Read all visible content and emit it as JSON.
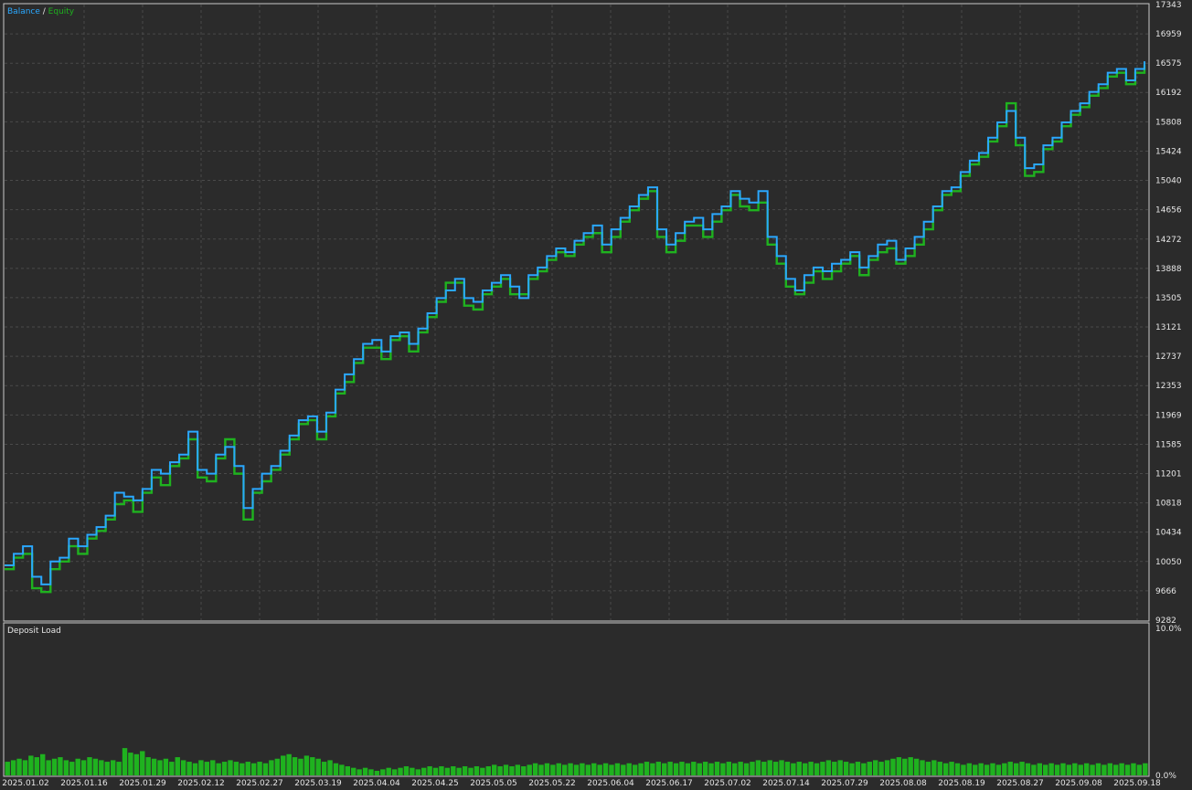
{
  "legend": {
    "balance_label": "Balance",
    "separator": " / ",
    "equity_label": "Equity"
  },
  "colors": {
    "background": "#2b2b2b",
    "grid": "#4a4a4a",
    "balance": "#2aa8ff",
    "equity": "#1fb21f",
    "volume": "#1fb21f",
    "text": "#e6e6e6",
    "border": "#c8c8c8"
  },
  "chart_data": [
    {
      "type": "line",
      "title": "",
      "legend_position": "top-left",
      "grid": true,
      "ylim": [
        9282,
        17343
      ],
      "y_ticks": [
        "17343",
        "16959",
        "16575",
        "16192",
        "15808",
        "15424",
        "15040",
        "14656",
        "14272",
        "13888",
        "13505",
        "13121",
        "12737",
        "12353",
        "11969",
        "11585",
        "11201",
        "10818",
        "10434",
        "10050",
        "9666",
        "9282"
      ],
      "x_ticks": [
        "2025.01.02",
        "2025.01.16",
        "2025.01.29",
        "2025.02.12",
        "2025.02.27",
        "2025.03.19",
        "2025.04.04",
        "2025.04.25",
        "2025.05.05",
        "2025.05.22",
        "2025.06.04",
        "2025.06.17",
        "2025.07.02",
        "2025.07.14",
        "2025.07.29",
        "2025.08.08",
        "2025.08.19",
        "2025.08.27",
        "2025.09.08",
        "2025.09.18"
      ],
      "series": [
        {
          "name": "Balance",
          "x": [
            0,
            10,
            20,
            30,
            40,
            50,
            60,
            70,
            80,
            90,
            100,
            110,
            120,
            130,
            140,
            150,
            160,
            170,
            180,
            190,
            200,
            210,
            220,
            230,
            240,
            250,
            260,
            270,
            280,
            290,
            300,
            310,
            320,
            330,
            340,
            350,
            360,
            370,
            380,
            390,
            400,
            410,
            420,
            430,
            440,
            450,
            460,
            470,
            480,
            490,
            500,
            510,
            520,
            530,
            540,
            550,
            560,
            570,
            580,
            590,
            600,
            610,
            620,
            630,
            640,
            650,
            660,
            670,
            680,
            690,
            700,
            710,
            720,
            730,
            740,
            750,
            760,
            770,
            780,
            790,
            800,
            810,
            820,
            830,
            840,
            850,
            860,
            870,
            880,
            890,
            900,
            910,
            920,
            930,
            940,
            950,
            960,
            970,
            980,
            990,
            1000,
            1010,
            1020,
            1030,
            1040,
            1050,
            1060,
            1070,
            1080,
            1090,
            1100,
            1110,
            1120,
            1130,
            1140,
            1150,
            1160,
            1170,
            1180,
            1190,
            1200,
            1210,
            1220,
            1230,
            1240
          ],
          "y": [
            10000,
            10150,
            10250,
            9850,
            9750,
            10050,
            10100,
            10350,
            10250,
            10400,
            10500,
            10650,
            10950,
            10900,
            10850,
            11000,
            11250,
            11200,
            11350,
            11450,
            11750,
            11250,
            11200,
            11450,
            11550,
            11300,
            10750,
            11000,
            11200,
            11300,
            11500,
            11700,
            11900,
            11950,
            11750,
            12000,
            12300,
            12500,
            12700,
            12900,
            12950,
            12800,
            13000,
            13050,
            12900,
            13100,
            13300,
            13500,
            13600,
            13750,
            13500,
            13450,
            13600,
            13700,
            13800,
            13650,
            13500,
            13800,
            13900,
            14050,
            14150,
            14100,
            14250,
            14350,
            14450,
            14200,
            14400,
            14550,
            14700,
            14850,
            14950,
            14400,
            14200,
            14350,
            14500,
            14550,
            14400,
            14600,
            14700,
            14900,
            14800,
            14750,
            14900,
            14300,
            14050,
            13750,
            13600,
            13800,
            13900,
            13850,
            13950,
            14000,
            14100,
            13900,
            14050,
            14200,
            14250,
            14000,
            14150,
            14300,
            14500,
            14700,
            14900,
            14950,
            15150,
            15300,
            15400,
            15600,
            15800,
            15950,
            15600,
            15200,
            15250,
            15500,
            15600,
            15800,
            15950,
            16050,
            16200,
            16300,
            16450,
            16500,
            16350,
            16500,
            16600
          ]
        },
        {
          "name": "Equity",
          "x": [
            0,
            10,
            20,
            30,
            40,
            50,
            60,
            70,
            80,
            90,
            100,
            110,
            120,
            130,
            140,
            150,
            160,
            170,
            180,
            190,
            200,
            210,
            220,
            230,
            240,
            250,
            260,
            270,
            280,
            290,
            300,
            310,
            320,
            330,
            340,
            350,
            360,
            370,
            380,
            390,
            400,
            410,
            420,
            430,
            440,
            450,
            460,
            470,
            480,
            490,
            500,
            510,
            520,
            530,
            540,
            550,
            560,
            570,
            580,
            590,
            600,
            610,
            620,
            630,
            640,
            650,
            660,
            670,
            680,
            690,
            700,
            710,
            720,
            730,
            740,
            750,
            760,
            770,
            780,
            790,
            800,
            810,
            820,
            830,
            840,
            850,
            860,
            870,
            880,
            890,
            900,
            910,
            920,
            930,
            940,
            950,
            960,
            970,
            980,
            990,
            1000,
            1010,
            1020,
            1030,
            1040,
            1050,
            1060,
            1070,
            1080,
            1090,
            1100,
            1110,
            1120,
            1130,
            1140,
            1150,
            1160,
            1170,
            1180,
            1190,
            1200,
            1210,
            1220,
            1230,
            1240
          ],
          "y": [
            9950,
            10100,
            10150,
            9700,
            9650,
            9950,
            10050,
            10250,
            10150,
            10350,
            10450,
            10600,
            10800,
            10850,
            10700,
            10950,
            11150,
            11050,
            11300,
            11400,
            11650,
            11150,
            11100,
            11400,
            11650,
            11200,
            10600,
            10950,
            11100,
            11250,
            11450,
            11650,
            11850,
            11900,
            11650,
            11950,
            12250,
            12400,
            12650,
            12850,
            12850,
            12700,
            12950,
            13000,
            12800,
            13050,
            13250,
            13450,
            13700,
            13700,
            13400,
            13350,
            13550,
            13650,
            13750,
            13550,
            13550,
            13750,
            13850,
            14000,
            14100,
            14050,
            14200,
            14300,
            14350,
            14100,
            14300,
            14500,
            14650,
            14800,
            14900,
            14300,
            14100,
            14250,
            14450,
            14450,
            14300,
            14500,
            14650,
            14850,
            14700,
            14650,
            14750,
            14200,
            13950,
            13650,
            13550,
            13700,
            13850,
            13750,
            13850,
            13950,
            14050,
            13800,
            14000,
            14100,
            14150,
            13950,
            14050,
            14200,
            14400,
            14650,
            14850,
            14900,
            15100,
            15250,
            15350,
            15550,
            15750,
            16050,
            15500,
            15100,
            15150,
            15450,
            15550,
            15750,
            15900,
            16000,
            16150,
            16250,
            16400,
            16450,
            16300,
            16450,
            16550
          ]
        }
      ]
    },
    {
      "type": "bar",
      "title": "Deposit Load",
      "ylim": [
        0,
        10
      ],
      "y_ticks": [
        "10.0%",
        "0.0%"
      ],
      "values": [
        0.9,
        1.0,
        1.1,
        1.0,
        1.3,
        1.2,
        1.4,
        1.0,
        1.1,
        1.2,
        1.0,
        0.9,
        1.1,
        1.0,
        1.2,
        1.1,
        1.0,
        0.9,
        1.0,
        0.9,
        1.8,
        1.5,
        1.4,
        1.6,
        1.2,
        1.1,
        1.0,
        1.1,
        0.9,
        1.2,
        1.0,
        0.9,
        0.8,
        1.0,
        0.9,
        1.0,
        0.8,
        0.9,
        1.0,
        0.9,
        0.8,
        0.9,
        0.8,
        0.9,
        0.8,
        1.0,
        1.1,
        1.3,
        1.4,
        1.2,
        1.1,
        1.3,
        1.2,
        1.1,
        0.9,
        1.0,
        0.8,
        0.7,
        0.6,
        0.5,
        0.4,
        0.5,
        0.4,
        0.3,
        0.4,
        0.5,
        0.4,
        0.5,
        0.6,
        0.5,
        0.4,
        0.5,
        0.6,
        0.5,
        0.6,
        0.5,
        0.6,
        0.5,
        0.6,
        0.5,
        0.6,
        0.5,
        0.6,
        0.7,
        0.6,
        0.7,
        0.6,
        0.7,
        0.6,
        0.7,
        0.8,
        0.7,
        0.8,
        0.7,
        0.8,
        0.7,
        0.8,
        0.7,
        0.8,
        0.7,
        0.8,
        0.7,
        0.8,
        0.7,
        0.8,
        0.7,
        0.8,
        0.7,
        0.8,
        0.9,
        0.8,
        0.9,
        0.8,
        0.9,
        0.8,
        0.9,
        0.8,
        0.9,
        0.8,
        0.9,
        0.8,
        0.9,
        0.8,
        0.9,
        0.8,
        0.9,
        0.8,
        0.9,
        1.0,
        0.9,
        1.0,
        0.9,
        1.0,
        0.9,
        0.8,
        0.9,
        0.8,
        0.9,
        0.8,
        0.9,
        1.0,
        0.9,
        1.0,
        0.9,
        0.8,
        0.9,
        0.8,
        0.9,
        1.0,
        0.9,
        1.0,
        1.1,
        1.2,
        1.1,
        1.2,
        1.1,
        1.0,
        0.9,
        1.0,
        0.9,
        0.8,
        0.9,
        0.8,
        0.7,
        0.8,
        0.7,
        0.8,
        0.7,
        0.8,
        0.7,
        0.8,
        0.9,
        0.8,
        0.9,
        0.8,
        0.7,
        0.8,
        0.7,
        0.8,
        0.7,
        0.8,
        0.7,
        0.8,
        0.7,
        0.8,
        0.7,
        0.8,
        0.7,
        0.8,
        0.7,
        0.8,
        0.7,
        0.8,
        0.7,
        0.8
      ]
    }
  ]
}
